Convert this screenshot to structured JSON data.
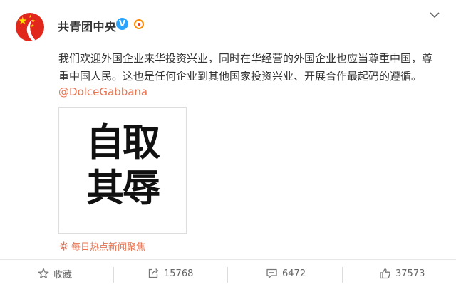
{
  "post": {
    "author": "共青团中央",
    "verified_badge": "V",
    "text": "我们欢迎外国企业来华投资兴业，同时在华经营的外国企业也应当尊重中国，尊重中国人民。这也是任何企业到其他国家投资兴业、开展合作最起码的遵循。",
    "mention": "@DolceGabbana",
    "image": {
      "line1": "自取",
      "line2": "其辱"
    },
    "source": "每日热点新闻聚焦"
  },
  "actions": {
    "favorite_label": "收藏",
    "repost_count": "15768",
    "comment_count": "6472",
    "like_count": "37573"
  },
  "colors": {
    "accent": "#eb7350",
    "verified": "#2aa5ff",
    "avatar_red": "#e1261c"
  },
  "icons": [
    "avatar-emblem-icon",
    "verified-icon",
    "medal-icon",
    "chevron-down-icon",
    "star-icon",
    "repost-icon",
    "comment-icon",
    "like-icon",
    "sparkle-icon"
  ]
}
